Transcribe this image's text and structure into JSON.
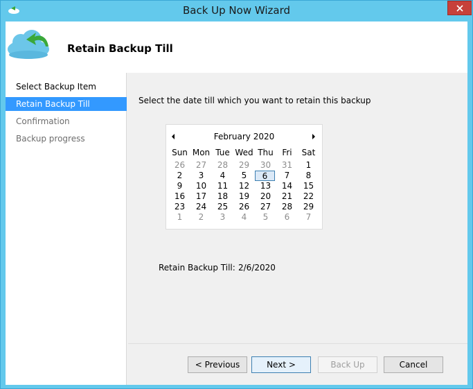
{
  "window": {
    "title": "Back Up Now Wizard"
  },
  "header": {
    "title": "Retain Backup Till"
  },
  "steps": [
    {
      "label": "Select Backup Item",
      "state": "done"
    },
    {
      "label": "Retain Backup Till",
      "state": "active"
    },
    {
      "label": "Confirmation",
      "state": "future"
    },
    {
      "label": "Backup progress",
      "state": "future"
    }
  ],
  "content": {
    "instruction": "Select the date till which you want to retain this backup",
    "retain_label": "Retain Backup Till:",
    "retain_value": "2/6/2020"
  },
  "calendar": {
    "month": "February 2020",
    "days_of_week": [
      "Sun",
      "Mon",
      "Tue",
      "Wed",
      "Thu",
      "Fri",
      "Sat"
    ],
    "weeks": [
      [
        "26",
        "27",
        "28",
        "29",
        "30",
        "31",
        "1"
      ],
      [
        "2",
        "3",
        "4",
        "5",
        "6",
        "7",
        "8"
      ],
      [
        "9",
        "10",
        "11",
        "12",
        "13",
        "14",
        "15"
      ],
      [
        "16",
        "17",
        "18",
        "19",
        "20",
        "21",
        "22"
      ],
      [
        "23",
        "24",
        "25",
        "26",
        "27",
        "28",
        "29"
      ],
      [
        "1",
        "2",
        "3",
        "4",
        "5",
        "6",
        "7"
      ]
    ],
    "dim": [
      [
        true,
        true,
        true,
        true,
        true,
        true,
        false
      ],
      [
        false,
        false,
        false,
        false,
        false,
        false,
        false
      ],
      [
        false,
        false,
        false,
        false,
        false,
        false,
        false
      ],
      [
        false,
        false,
        false,
        false,
        false,
        false,
        false
      ],
      [
        false,
        false,
        false,
        false,
        false,
        false,
        false
      ],
      [
        true,
        true,
        true,
        true,
        true,
        true,
        true
      ]
    ],
    "selected": "6"
  },
  "buttons": {
    "previous": "< Previous",
    "next": "Next >",
    "backup": "Back Up",
    "cancel": "Cancel"
  },
  "icons": {
    "title": "backup-arrow-icon",
    "header": "cloud-backup-icon",
    "close": "close-icon",
    "prev_month": "triangle-left-icon",
    "next_month": "triangle-right-icon"
  },
  "colors": {
    "titlebar": "#63c9ec",
    "close": "#c7403a",
    "active_step": "#3399ff",
    "arrow_green": "#3aa83a"
  }
}
